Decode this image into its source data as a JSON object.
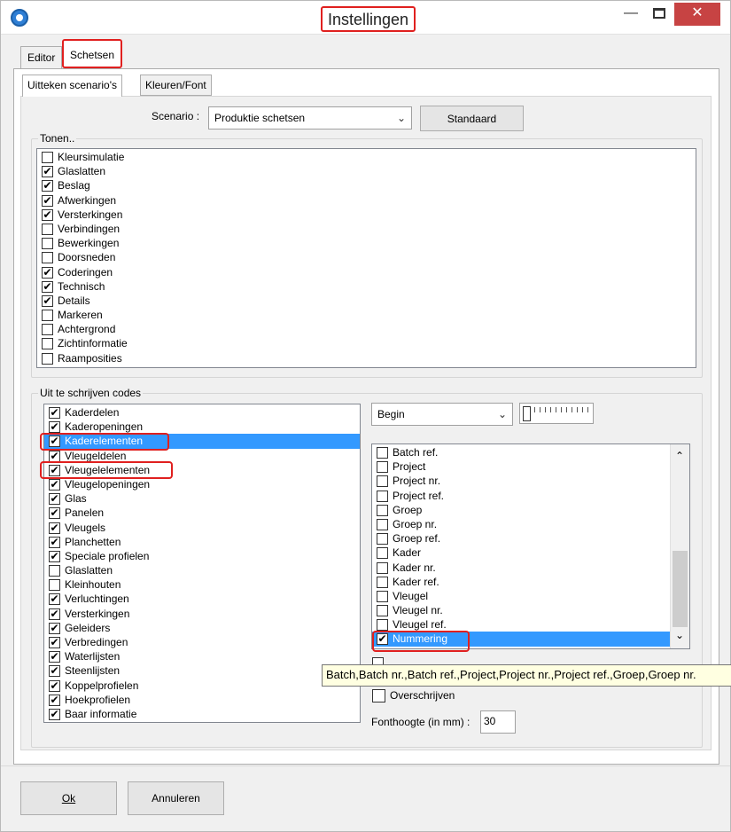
{
  "window": {
    "title": "Instellingen",
    "minimize": "—",
    "close": "✕"
  },
  "tabs": [
    "Editor",
    "Schetsen"
  ],
  "subtabs": [
    "Uitteken scenario's",
    "Kleuren/Font"
  ],
  "scenario": {
    "label": "Scenario :",
    "value": "Produktie schetsen",
    "standaard_button": "Standaard"
  },
  "tonen": {
    "label": "Tonen..",
    "items": [
      {
        "label": "Kleursimulatie",
        "checked": false
      },
      {
        "label": "Glaslatten",
        "checked": true
      },
      {
        "label": "Beslag",
        "checked": true
      },
      {
        "label": "Afwerkingen",
        "checked": true
      },
      {
        "label": "Versterkingen",
        "checked": true
      },
      {
        "label": "Verbindingen",
        "checked": false
      },
      {
        "label": "Bewerkingen",
        "checked": false
      },
      {
        "label": "Doorsneden",
        "checked": false
      },
      {
        "label": "Coderingen",
        "checked": true
      },
      {
        "label": "Technisch",
        "checked": true
      },
      {
        "label": "Details",
        "checked": true
      },
      {
        "label": "Markeren",
        "checked": false
      },
      {
        "label": "Achtergrond",
        "checked": false
      },
      {
        "label": "Zichtinformatie",
        "checked": false
      },
      {
        "label": "Raamposities",
        "checked": false
      }
    ]
  },
  "codes": {
    "label": "Uit te schrijven codes",
    "items": [
      {
        "label": "Kaderdelen",
        "checked": true
      },
      {
        "label": "Kaderopeningen",
        "checked": true
      },
      {
        "label": "Kaderelementen",
        "checked": true,
        "selected": true
      },
      {
        "label": "Vleugeldelen",
        "checked": true
      },
      {
        "label": "Vleugelelementen",
        "checked": true
      },
      {
        "label": "Vleugelopeningen",
        "checked": true
      },
      {
        "label": "Glas",
        "checked": true
      },
      {
        "label": "Panelen",
        "checked": true
      },
      {
        "label": "Vleugels",
        "checked": true
      },
      {
        "label": "Planchetten",
        "checked": true
      },
      {
        "label": "Speciale profielen",
        "checked": true
      },
      {
        "label": "Glaslatten",
        "checked": false
      },
      {
        "label": "Kleinhouten",
        "checked": false
      },
      {
        "label": "Verluchtingen",
        "checked": true
      },
      {
        "label": "Versterkingen",
        "checked": true
      },
      {
        "label": "Geleiders",
        "checked": true
      },
      {
        "label": "Verbredingen",
        "checked": true
      },
      {
        "label": "Waterlijsten",
        "checked": true
      },
      {
        "label": "Steenlijsten",
        "checked": true
      },
      {
        "label": "Koppelprofielen",
        "checked": true
      },
      {
        "label": "Hoekprofielen",
        "checked": true
      },
      {
        "label": "Baar informatie",
        "checked": true
      }
    ]
  },
  "position": {
    "value": "Begin"
  },
  "fields": {
    "items": [
      {
        "label": "Batch ref.",
        "checked": false
      },
      {
        "label": "Project",
        "checked": false
      },
      {
        "label": "Project nr.",
        "checked": false
      },
      {
        "label": "Project ref.",
        "checked": false
      },
      {
        "label": "Groep",
        "checked": false
      },
      {
        "label": "Groep nr.",
        "checked": false
      },
      {
        "label": "Groep ref.",
        "checked": false
      },
      {
        "label": "Kader",
        "checked": false
      },
      {
        "label": "Kader nr.",
        "checked": false
      },
      {
        "label": "Kader ref.",
        "checked": false
      },
      {
        "label": "Vleugel",
        "checked": false
      },
      {
        "label": "Vleugel nr.",
        "checked": false
      },
      {
        "label": "Vleugel ref.",
        "checked": false
      },
      {
        "label": "Nummering",
        "checked": true,
        "selected": true
      }
    ]
  },
  "tooltip": "Batch,Batch nr.,Batch ref.,Project,Project nr.,Project ref.,Groep,Groep nr.",
  "overschrijven": {
    "label": "Overschrijven",
    "checked": false
  },
  "fonthoogte": {
    "label": "Fonthoogte (in mm) :",
    "value": "30"
  },
  "buttons": {
    "ok": "Ok",
    "annuleren": "Annuleren"
  }
}
